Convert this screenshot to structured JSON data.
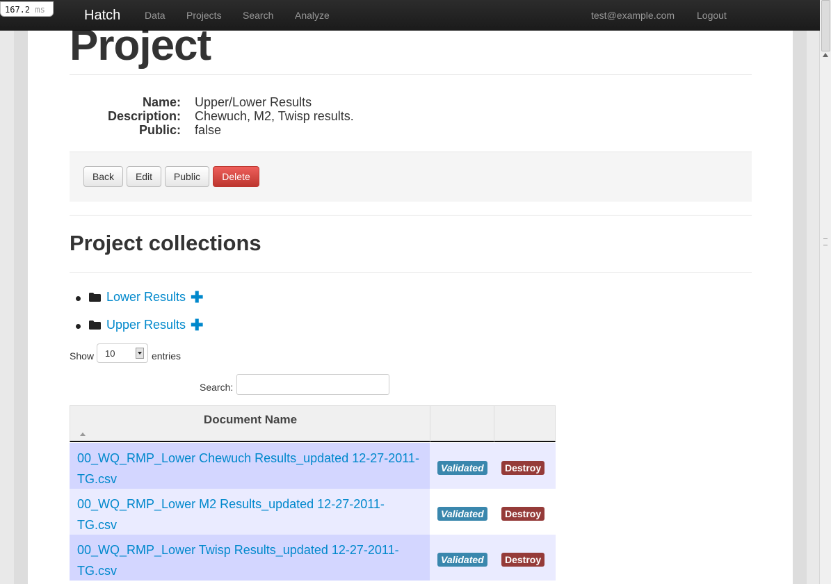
{
  "timer": {
    "value": "167.2",
    "unit": "ms"
  },
  "navbar": {
    "brand": "Hatch",
    "links": [
      "Data",
      "Projects",
      "Search",
      "Analyze"
    ],
    "user_email": "test@example.com",
    "logout": "Logout"
  },
  "page": {
    "title": "Project",
    "details": {
      "name_label": "Name:",
      "name_value": "Upper/Lower Results",
      "description_label": "Description:",
      "description_value": "Chewuch, M2, Twisp results.",
      "public_label": "Public:",
      "public_value": "false"
    },
    "actions": {
      "back": "Back",
      "edit": "Edit",
      "public": "Public",
      "delete": "Delete"
    }
  },
  "collections": {
    "title": "Project collections",
    "items": [
      {
        "label": "Lower Results",
        "icon": "folder-icon",
        "action_icon": "plus-icon"
      },
      {
        "label": "Upper Results",
        "icon": "folder-icon",
        "action_icon": "plus-icon"
      }
    ]
  },
  "table_controls": {
    "show_label": "Show",
    "entries_value": "10",
    "entries_label": "entries",
    "search_label": "Search:",
    "search_value": ""
  },
  "table": {
    "columns": [
      "Document Name",
      "",
      ""
    ],
    "rows": [
      {
        "name": "00_WQ_RMP_Lower Chewuch Results_updated 12-27-2011-TG.csv",
        "status": "Validated",
        "action": "Destroy"
      },
      {
        "name": "00_WQ_RMP_Lower M2 Results_updated 12-27-2011-TG.csv",
        "status": "Validated",
        "action": "Destroy"
      },
      {
        "name": "00_WQ_RMP_Lower Twisp Results_updated 12-27-2011-TG.csv",
        "status": "Validated",
        "action": "Destroy"
      }
    ]
  },
  "colors": {
    "link": "#0088cc",
    "validated_badge": "#3a87ad",
    "destroy_badge": "#953b39",
    "danger_button": "#da4f49",
    "row_odd": "#d3d6ff",
    "row_even": "#eaebff"
  }
}
